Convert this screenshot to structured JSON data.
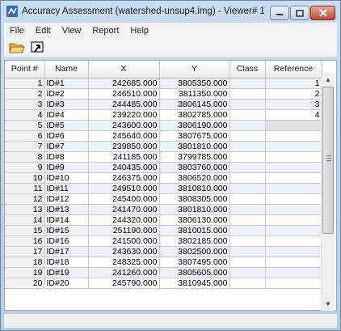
{
  "window": {
    "title": "Accuracy Assessment (watershed-unsup4.img) - Viewer# 1"
  },
  "menu": [
    {
      "label": "File"
    },
    {
      "label": "Edit"
    },
    {
      "label": "View"
    },
    {
      "label": "Report"
    },
    {
      "label": "Help"
    }
  ],
  "toolbar": {
    "icons": [
      "open-folder-icon",
      "select-viewer-icon"
    ]
  },
  "table": {
    "headers": [
      "Point #",
      "Name",
      "X",
      "Y",
      "Class",
      "Reference"
    ],
    "rows": [
      {
        "point": "1",
        "name": "ID#1",
        "x": "242685.000",
        "y": "3805350.000",
        "class": "",
        "reference": "1"
      },
      {
        "point": "2",
        "name": "ID#2",
        "x": "246510.000",
        "y": "3811350.000",
        "class": "",
        "reference": "2"
      },
      {
        "point": "3",
        "name": "ID#3",
        "x": "244485.000",
        "y": "3806145.000",
        "class": "",
        "reference": "3"
      },
      {
        "point": "4",
        "name": "ID#4",
        "x": "239220.000",
        "y": "3802785.000",
        "class": "",
        "reference": "4"
      },
      {
        "point": "5",
        "name": "ID#5",
        "x": "243600.000",
        "y": "3806190.000",
        "class": "",
        "reference": ""
      },
      {
        "point": "6",
        "name": "ID#6",
        "x": "245640.000",
        "y": "3807675.000",
        "class": "",
        "reference": ""
      },
      {
        "point": "7",
        "name": "ID#7",
        "x": "239850.000",
        "y": "3801810.000",
        "class": "",
        "reference": ""
      },
      {
        "point": "8",
        "name": "ID#8",
        "x": "241185.000",
        "y": "3799785.000",
        "class": "",
        "reference": ""
      },
      {
        "point": "9",
        "name": "ID#9",
        "x": "240435.000",
        "y": "3803760.000",
        "class": "",
        "reference": ""
      },
      {
        "point": "10",
        "name": "ID#10",
        "x": "246375.000",
        "y": "3806520.000",
        "class": "",
        "reference": ""
      },
      {
        "point": "11",
        "name": "ID#11",
        "x": "249510.000",
        "y": "3810810.000",
        "class": "",
        "reference": ""
      },
      {
        "point": "12",
        "name": "ID#12",
        "x": "245400.000",
        "y": "3808305.000",
        "class": "",
        "reference": ""
      },
      {
        "point": "13",
        "name": "ID#13",
        "x": "241470.000",
        "y": "3801810.000",
        "class": "",
        "reference": ""
      },
      {
        "point": "14",
        "name": "ID#14",
        "x": "244320.000",
        "y": "3806130.000",
        "class": "",
        "reference": ""
      },
      {
        "point": "15",
        "name": "ID#15",
        "x": "251190.000",
        "y": "3810015.000",
        "class": "",
        "reference": ""
      },
      {
        "point": "16",
        "name": "ID#16",
        "x": "241500.000",
        "y": "3802185.000",
        "class": "",
        "reference": ""
      },
      {
        "point": "17",
        "name": "ID#17",
        "x": "243630.000",
        "y": "3802500.000",
        "class": "",
        "reference": ""
      },
      {
        "point": "18",
        "name": "ID#18",
        "x": "248325.000",
        "y": "3807495.000",
        "class": "",
        "reference": ""
      },
      {
        "point": "19",
        "name": "ID#19",
        "x": "241260.000",
        "y": "3805605.000",
        "class": "",
        "reference": ""
      },
      {
        "point": "20",
        "name": "ID#20",
        "x": "245790.000",
        "y": "3810945.000",
        "class": "",
        "reference": ""
      }
    ]
  }
}
